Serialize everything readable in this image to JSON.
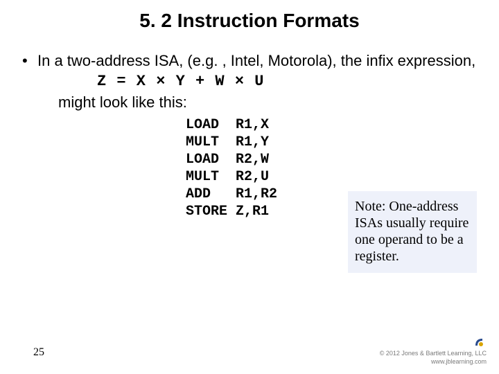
{
  "title": "5. 2 Instruction Formats",
  "bullet_lead": "In a two-address ISA, (e.g. , Intel, Motorola), the infix expression,",
  "infix": "Z = X × Y + W × U",
  "followup": "might look like this:",
  "code": "LOAD  R1,X\nMULT  R1,Y\nLOAD  R2,W\nMULT  R2,U\nADD   R1,R2\nSTORE Z,R1",
  "note": "Note: One-address ISAs usually require one operand to be a register.",
  "page_number": "25",
  "copyright_line1": "© 2012 Jones & Bartlett Learning, LLC",
  "copyright_line2": "www.jblearning.com"
}
